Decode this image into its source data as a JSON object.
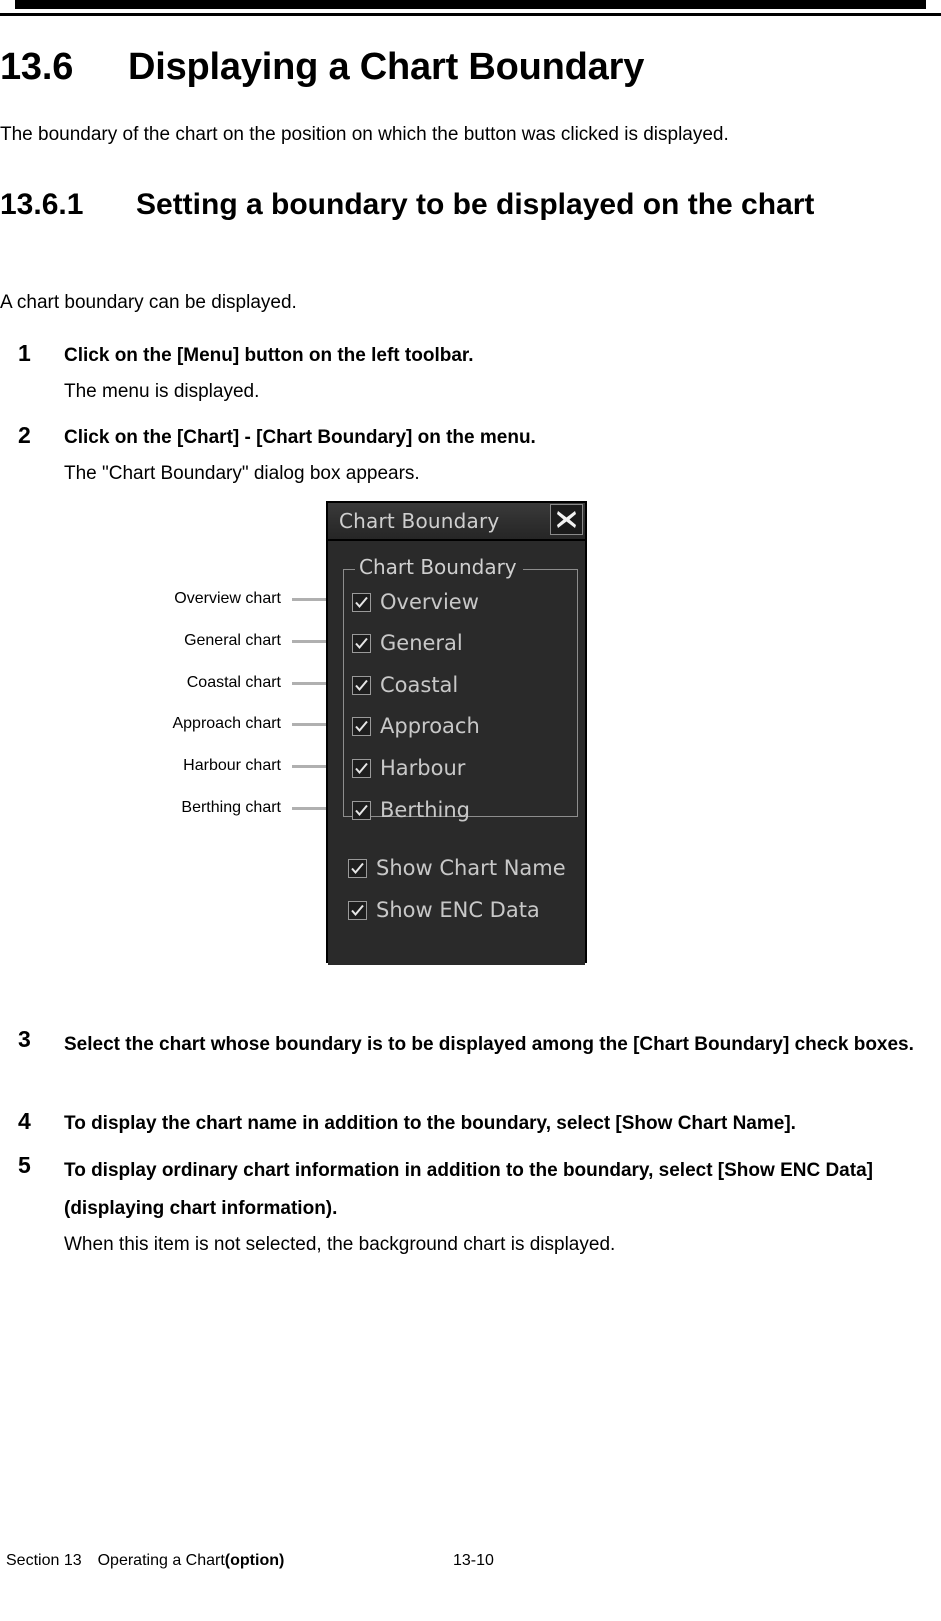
{
  "page": {
    "heading_number": "13.6",
    "heading_title": "Displaying a Chart Boundary",
    "intro": "The boundary of the chart on the position on which the button was clicked is displayed.",
    "sub_heading_number": "13.6.1",
    "sub_heading_title": "Setting a boundary to be displayed on the chart",
    "lead": "A chart boundary can be displayed."
  },
  "steps": [
    {
      "number": "1",
      "title": "Click on the [Menu] button on the left toolbar.",
      "sub": "The menu is displayed."
    },
    {
      "number": "2",
      "title": "Click on the [Chart] - [Chart Boundary] on the menu.",
      "sub": "The \"Chart Boundary\" dialog box appears."
    },
    {
      "number": "3",
      "title": "Select the chart whose boundary is to be displayed among the [Chart Boundary] check boxes.",
      "sub": ""
    },
    {
      "number": "4",
      "title": "To display the chart name in addition to the boundary, select [Show Chart Name].",
      "sub": ""
    },
    {
      "number": "5",
      "title": "To display ordinary chart information in addition to the boundary, select [Show ENC Data] (displaying chart information).",
      "sub": "When this item is not selected, the background chart is displayed."
    }
  ],
  "dialog": {
    "title": "Chart Boundary",
    "close_icon": "close-x-icon",
    "group_legend": "Chart Boundary",
    "group_items": [
      {
        "label": "Overview",
        "checked": true
      },
      {
        "label": "General",
        "checked": true
      },
      {
        "label": "Coastal",
        "checked": true
      },
      {
        "label": "Approach",
        "checked": true
      },
      {
        "label": "Harbour",
        "checked": true
      },
      {
        "label": "Berthing",
        "checked": true
      }
    ],
    "outer_items": [
      {
        "label": "Show Chart Name",
        "checked": true
      },
      {
        "label": "Show ENC Data",
        "checked": true
      }
    ],
    "colors": {
      "background": "#2a2a2a",
      "titlebar": "#333333",
      "text": "#c8c8c8",
      "border": "#8d8d8d"
    }
  },
  "callouts": [
    {
      "label": "Overview chart"
    },
    {
      "label": "General chart"
    },
    {
      "label": "Coastal chart"
    },
    {
      "label": "Approach chart"
    },
    {
      "label": "Harbour chart"
    },
    {
      "label": "Berthing chart"
    }
  ],
  "footer": {
    "section": "Section 13 Operating a Chart ",
    "section_bold": "(option)",
    "page_number": "13-10"
  }
}
